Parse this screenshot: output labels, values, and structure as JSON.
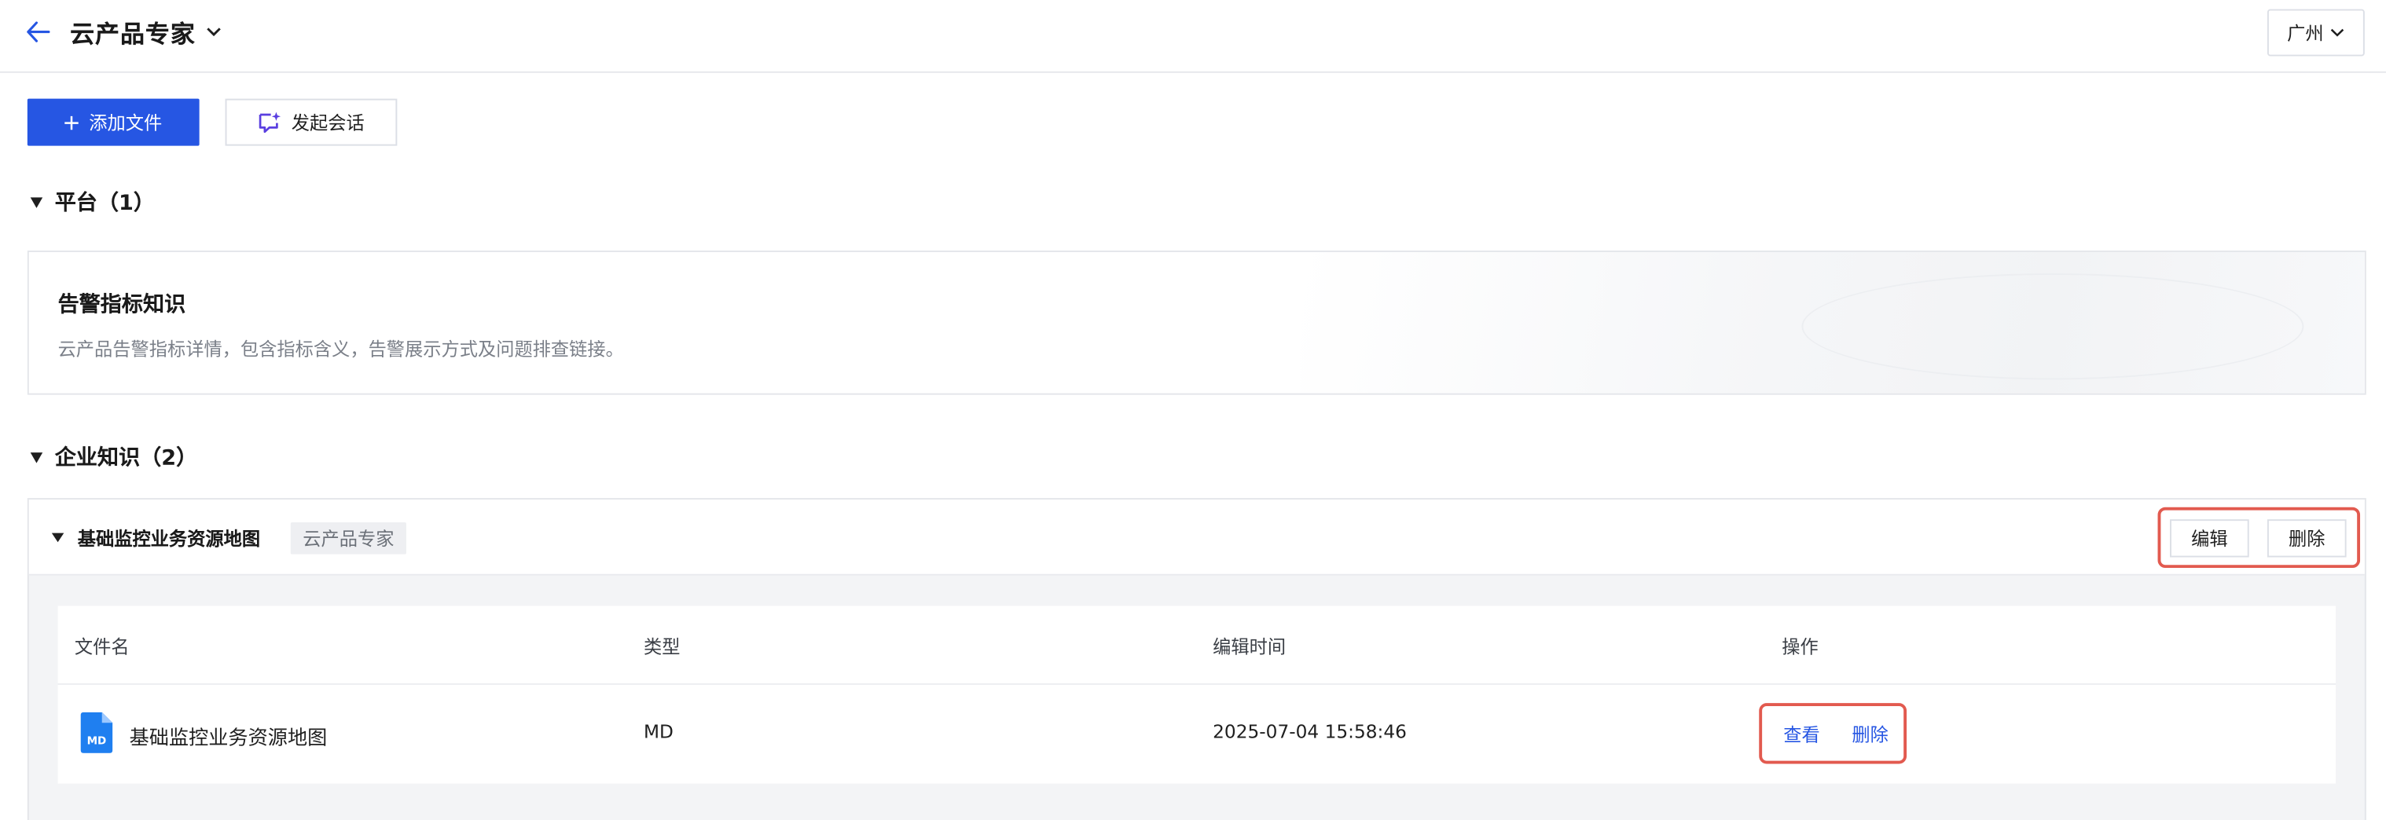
{
  "header": {
    "title": "云产品专家",
    "region": "广州"
  },
  "toolbar": {
    "add_file_label": "添加文件",
    "start_chat_label": "发起会话"
  },
  "platform": {
    "section_title": "平台（1）",
    "card": {
      "title": "告警指标知识",
      "description": "云产品告警指标详情，包含指标含义，告警展示方式及问题排查链接。"
    }
  },
  "enterprise": {
    "section_title": "企业知识（2）",
    "knowledge_base": {
      "name": "基础监控业务资源地图",
      "tag": "云产品专家",
      "edit_label": "编辑",
      "delete_label": "删除"
    },
    "table": {
      "columns": [
        "文件名",
        "类型",
        "编辑时间",
        "操作"
      ],
      "rows": [
        {
          "file_name": "基础监控业务资源地图",
          "type": "MD",
          "edited_at": "2025-07-04 15:58:46",
          "icon": "md-file-icon",
          "icon_text": "MD",
          "actions": [
            "查看",
            "删除"
          ]
        }
      ]
    }
  },
  "colors": {
    "primary": "#2656e3",
    "highlight": "#e25a4f",
    "file_icon": "#1f7ff0"
  }
}
